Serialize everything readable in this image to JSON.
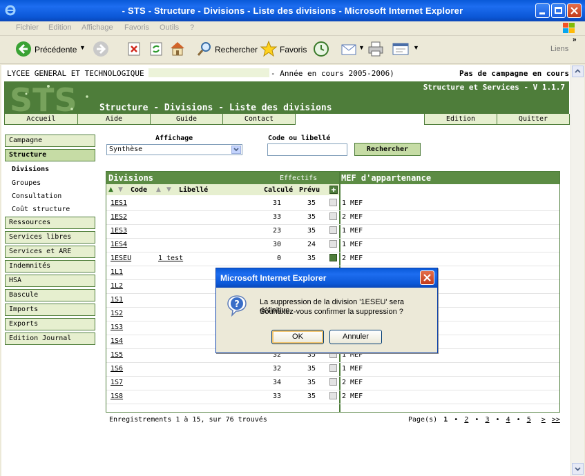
{
  "window": {
    "title": "- STS - Structure - Divisions - Liste des divisions - Microsoft Internet Explorer"
  },
  "menu": [
    "Fichier",
    "Edition",
    "Affichage",
    "Favoris",
    "Outils",
    "?"
  ],
  "toolbar": {
    "back": "Précédente",
    "search": "Rechercher",
    "favorites": "Favoris",
    "links": "Liens"
  },
  "header": {
    "school": "LYCEE GENERAL ET TECHNOLOGIQUE",
    "year": "- Année en cours 2005-2006)",
    "campaign": "Pas de campagne en cours",
    "logo": "STS",
    "version": "Structure et Services - V 1.1.7",
    "page_title": "Structure - Divisions - Liste des divisions"
  },
  "nav": {
    "accueil": "Accueil",
    "aide": "Aide",
    "guide": "Guide",
    "contact": "Contact",
    "edition": "Edition",
    "quitter": "Quitter"
  },
  "sidebar": {
    "campagne": "Campagne",
    "structure": "Structure",
    "sub": [
      "Divisions",
      "Groupes",
      "Consultation",
      "Coût structure"
    ],
    "items": [
      "Ressources",
      "Services libres",
      "Services et ARE",
      "Indemnités",
      "HSA",
      "Bascule",
      "Imports",
      "Exports",
      "Edition Journal"
    ]
  },
  "filters": {
    "affichage_label": "Affichage",
    "affichage_value": "Synthèse",
    "code_label": "Code ou libellé",
    "search_button": "Rechercher"
  },
  "table": {
    "title": "Divisions",
    "effectifs": "Effectifs",
    "mef_title": "MEF d'appartenance",
    "col_code": "Code",
    "col_libelle": "Libellé",
    "col_calcule": "Calculé",
    "col_prevu": "Prévu",
    "rows": [
      {
        "code": "1ES1",
        "libelle": "",
        "calcule": "31",
        "prevu": "35",
        "mef": "1 MEF",
        "checked": false
      },
      {
        "code": "1ES2",
        "libelle": "",
        "calcule": "33",
        "prevu": "35",
        "mef": "2 MEF",
        "checked": false
      },
      {
        "code": "1ES3",
        "libelle": "",
        "calcule": "23",
        "prevu": "35",
        "mef": "1 MEF",
        "checked": false
      },
      {
        "code": "1ES4",
        "libelle": "",
        "calcule": "30",
        "prevu": "24",
        "mef": "1 MEF",
        "checked": false
      },
      {
        "code": "1ESEU",
        "libelle": "1 test",
        "calcule": "0",
        "prevu": "35",
        "mef": "2 MEF",
        "checked": true
      },
      {
        "code": "1L1",
        "libelle": "",
        "calcule": "",
        "prevu": "",
        "mef": "",
        "checked": false
      },
      {
        "code": "1L2",
        "libelle": "",
        "calcule": "",
        "prevu": "",
        "mef": "",
        "checked": false
      },
      {
        "code": "1S1",
        "libelle": "",
        "calcule": "",
        "prevu": "",
        "mef": "",
        "checked": false
      },
      {
        "code": "1S2",
        "libelle": "",
        "calcule": "",
        "prevu": "",
        "mef": "",
        "checked": false
      },
      {
        "code": "1S3",
        "libelle": "",
        "calcule": "",
        "prevu": "",
        "mef": "",
        "checked": false
      },
      {
        "code": "1S4",
        "libelle": "",
        "calcule": "",
        "prevu": "",
        "mef": "",
        "checked": false
      },
      {
        "code": "1S5",
        "libelle": "",
        "calcule": "32",
        "prevu": "35",
        "mef": "1 MEF",
        "checked": false
      },
      {
        "code": "1S6",
        "libelle": "",
        "calcule": "32",
        "prevu": "35",
        "mef": "1 MEF",
        "checked": false
      },
      {
        "code": "1S7",
        "libelle": "",
        "calcule": "34",
        "prevu": "35",
        "mef": "2 MEF",
        "checked": false
      },
      {
        "code": "1S8",
        "libelle": "",
        "calcule": "33",
        "prevu": "35",
        "mef": "2 MEF",
        "checked": false
      }
    ]
  },
  "footer": {
    "records": "Enregistrements 1 à 15, sur 76 trouvés",
    "pages_label": "Page(s)",
    "pages": [
      "1",
      "•",
      "2",
      "•",
      "3",
      "•",
      "4",
      "•",
      "5",
      ">",
      ">>"
    ]
  },
  "dialog": {
    "title": "Microsoft Internet Explorer",
    "line1": "La suppression de la division '1ESEU' sera définitive.",
    "line2": "Souhaitez-vous confirmer la suppression ?",
    "ok": "OK",
    "cancel": "Annuler"
  }
}
